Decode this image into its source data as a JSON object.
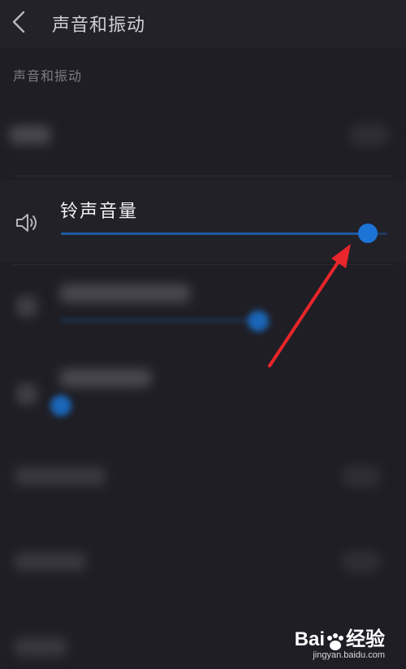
{
  "header": {
    "title": "声音和振动",
    "back_icon": "chevron-left-icon"
  },
  "section": {
    "title": "声音和振动"
  },
  "ringtone": {
    "label": "铃声音量",
    "icon": "speaker-icon",
    "volume_fraction": 0.94
  },
  "colors": {
    "background": "#1f1e24",
    "accent": "#1c74d6",
    "arrow": "#e8262b"
  },
  "watermark": {
    "brand_left": "Bai",
    "brand_right": "经验",
    "sub": "jingyan.baidu.com"
  }
}
